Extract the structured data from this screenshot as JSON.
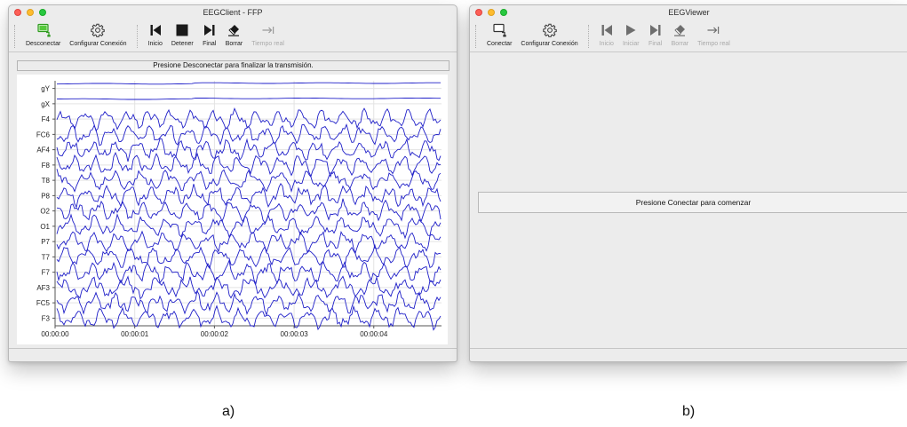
{
  "window_a": {
    "title": "EEGClient - FFP",
    "toolbar": {
      "disconnect_label": "Desconectar",
      "configure_label": "Configurar Conexión",
      "start_label": "Inicio",
      "stop_label": "Detener",
      "end_label": "Final",
      "clear_label": "Borrar",
      "realtime_label": "Tiempo real"
    },
    "message": "Presione Desconectar para finalizar la transmisión."
  },
  "window_b": {
    "title": "EEGViewer",
    "toolbar": {
      "connect_label": "Conectar",
      "configure_label": "Configurar Conexión",
      "start_label": "Inicio",
      "play_label": "Iniciar",
      "end_label": "Final",
      "clear_label": "Borrar",
      "realtime_label": "Tiempo real"
    },
    "message": "Presione Conectar para comenzar"
  },
  "captions": {
    "a": "a)",
    "b": "b)"
  },
  "colors": {
    "trace": "#1f1fc8",
    "grid": "#e3e3e3",
    "axis": "#555555"
  },
  "icons": {
    "disconnect": "monitor-plug-icon",
    "connect": "monitor-plug-icon",
    "configure": "gear-icon",
    "start": "skip-to-start-icon",
    "stop": "stop-icon",
    "play": "play-icon",
    "end": "skip-to-end-icon",
    "clear": "eraser-icon",
    "realtime": "arrow-to-bar-icon"
  },
  "chart_data": {
    "type": "line",
    "title": "",
    "xlabel": "",
    "ylabel": "",
    "channels": [
      "gY",
      "gX",
      "F4",
      "FC6",
      "AF4",
      "F8",
      "T8",
      "P8",
      "O2",
      "O1",
      "P7",
      "T7",
      "F7",
      "AF3",
      "FC5",
      "F3"
    ],
    "x_tick_labels": [
      "00:00:00",
      "00:00:01",
      "00:00:02",
      "00:00:03",
      "00:00:04"
    ],
    "xlim_seconds": [
      0,
      4.85
    ],
    "grid": true,
    "legend": "none"
  }
}
